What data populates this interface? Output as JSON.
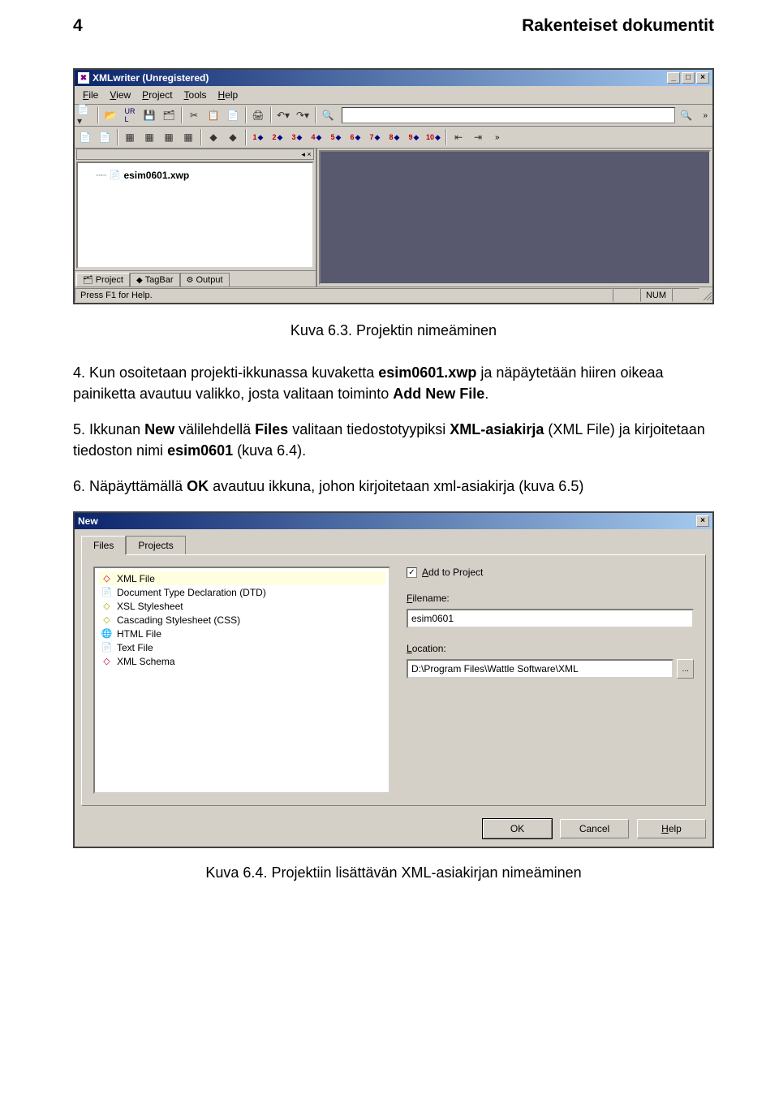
{
  "header": {
    "page_number": "4",
    "title": "Rakenteiset dokumentit"
  },
  "screenshot1": {
    "title": "XMLwriter (Unregistered)",
    "menu": {
      "file": "File",
      "view": "View",
      "project": "Project",
      "tools": "Tools",
      "help": "Help"
    },
    "tree_item": "esim0601.xwp",
    "tabs": {
      "project": "Project",
      "tagbar": "TagBar",
      "output": "Output"
    },
    "status": {
      "help": "Press F1 for Help.",
      "num": "NUM"
    }
  },
  "caption1": "Kuva 6.3. Projektin nimeäminen",
  "para4": {
    "num": "4.",
    "t1": "Kun osoitetaan projekti-ikkunassa kuvaketta ",
    "b1": "esim0601.xwp",
    "t2": " ja näpäytetään hiiren oikeaa painiketta avautuu valikko, josta valitaan toiminto ",
    "b2": "Add New File",
    "t3": "."
  },
  "para5": {
    "num": "5.",
    "t1": "Ikkunan ",
    "b1": "New",
    "t2": " välilehdellä ",
    "b2": "Files",
    "t3": " valitaan tiedostotyypiksi ",
    "b3": "XML-asiakirja",
    "t4": " (XML File) ja kirjoitetaan tiedoston nimi ",
    "b4": "esim0601",
    "t5": " (kuva 6.4)."
  },
  "para6": {
    "num": "6.",
    "t1": "Näpäyttämällä ",
    "b1": "OK",
    "t2": " avautuu ikkuna, johon kirjoitetaan xml-asiakirja (kuva 6.5)"
  },
  "dialog": {
    "title": "New",
    "tabs": {
      "files": "Files",
      "projects": "Projects"
    },
    "file_types": {
      "xml": "XML File",
      "dtd": "Document Type Declaration (DTD)",
      "xsl": "XSL Stylesheet",
      "css": "Cascading Stylesheet (CSS)",
      "html": "HTML File",
      "txt": "Text File",
      "xsd": "XML Schema"
    },
    "add_to_project": "Add to Project",
    "filename_label": "Filename:",
    "filename_value": "esim0601",
    "location_label": "Location:",
    "location_value": "D:\\Program Files\\Wattle Software\\XML",
    "buttons": {
      "ok": "OK",
      "cancel": "Cancel",
      "help": "Help"
    }
  },
  "caption2": "Kuva 6.4. Projektiin lisättävän XML-asiakirjan nimeäminen"
}
